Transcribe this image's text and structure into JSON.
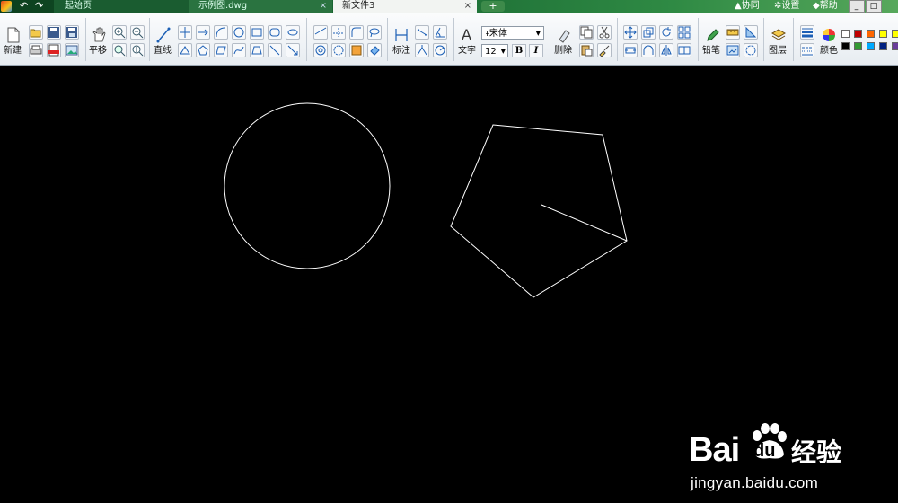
{
  "title_bar": {
    "tabs": [
      {
        "label": "起始页"
      },
      {
        "label": "示例图.dwg",
        "close": "×"
      },
      {
        "label": "新文件3",
        "close": "×"
      }
    ],
    "add_tab": "+",
    "collaborate": "协同",
    "settings": "设置",
    "help": "帮助"
  },
  "ribbon": {
    "file": {
      "new_label": "新建"
    },
    "view": {
      "pan_label": "平移"
    },
    "draw": {
      "line_label": "直线"
    },
    "annotate": {
      "dimension_label": "标注"
    },
    "text": {
      "text_label": "文字",
      "font_name": "宋体",
      "font_size": "12",
      "bold": "B",
      "italic": "I"
    },
    "edit": {
      "delete_label": "删除"
    },
    "tools": {
      "pencil_label": "铅笔"
    },
    "layers": {
      "layer_label": "图层"
    },
    "color": {
      "color_label": "颜色",
      "swatches_row1": [
        "#ffffff",
        "#c00000",
        "#ff6600",
        "#ffff00",
        "#ffff00"
      ],
      "swatches_row2": [
        "#000000",
        "#339933",
        "#00aaff",
        "#002080",
        "#6a3d9a"
      ]
    }
  },
  "canvas": {
    "background": "#000000",
    "stroke_color": "#ffffff",
    "shapes": [
      "circle",
      "pentagon",
      "line-segment"
    ]
  },
  "watermark": {
    "brand_left": "Bai",
    "brand_right": "du",
    "brand_cn": "经验",
    "url": "jingyan.baidu.com"
  }
}
